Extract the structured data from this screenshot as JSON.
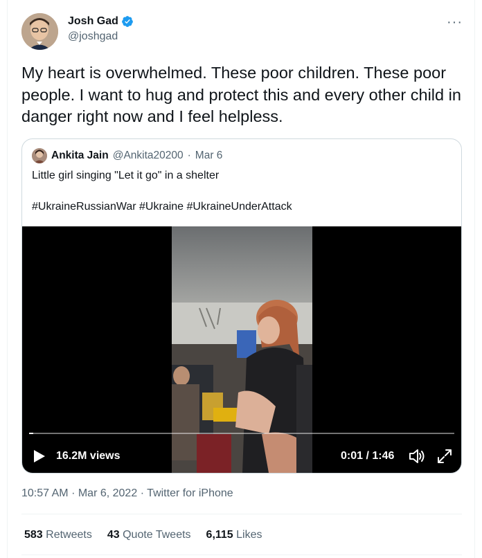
{
  "author": {
    "name": "Josh Gad",
    "handle": "@joshgad",
    "verified_icon": "verified-badge-icon",
    "more_label": "···"
  },
  "tweet": {
    "text": "My heart is overwhelmed. These poor children. These poor people. I want to hug and protect this and every other child in danger right now and I feel helpless."
  },
  "quote": {
    "name": "Ankita Jain",
    "handle": "@Ankita20200",
    "separator": "·",
    "date": "Mar 6",
    "text_line": "Little girl singing \"Let it go\" in a shelter",
    "hashtags": [
      "#UkraineRussianWar",
      "#Ukraine",
      "#UkraineUnderAttack"
    ]
  },
  "video": {
    "views": "16.2M views",
    "time": "0:01 / 1:46",
    "progress_fraction": 0.01
  },
  "meta": {
    "time": "10:57 AM",
    "date": "Mar 6, 2022",
    "source": "Twitter for iPhone",
    "dot": "·"
  },
  "stats": {
    "retweets_count": "583",
    "retweets_label": "Retweets",
    "quotes_count": "43",
    "quotes_label": "Quote Tweets",
    "likes_count": "6,115",
    "likes_label": "Likes"
  },
  "colors": {
    "verified": "#1d9bf0",
    "secondary_text": "#536471",
    "border": "#cfd9de"
  }
}
